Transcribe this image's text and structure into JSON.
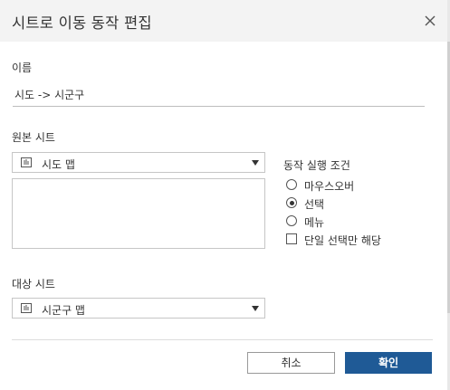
{
  "dialog": {
    "title": "시트로 이동 동작 편집"
  },
  "name_section": {
    "label": "이름",
    "value": "시도 -> 시군구"
  },
  "source_section": {
    "label": "원본 시트",
    "selected": "시도 맵"
  },
  "run_condition": {
    "label": "동작 실행 조건",
    "options": [
      "마우스오버",
      "선택",
      "메뉴"
    ],
    "selected": "선택",
    "single_select_label": "단일 선택만 해당",
    "single_select_checked": false
  },
  "target_section": {
    "label": "대상 시트",
    "selected": "시군구 맵"
  },
  "buttons": {
    "cancel": "취소",
    "ok": "확인"
  },
  "colors": {
    "header_bg": "#f3f3f3",
    "primary": "#1f5a96",
    "border": "#c6c6c6"
  },
  "icons": {
    "close": "close-icon",
    "sheet": "sheet-icon",
    "dropdown": "chevron-down-icon"
  }
}
